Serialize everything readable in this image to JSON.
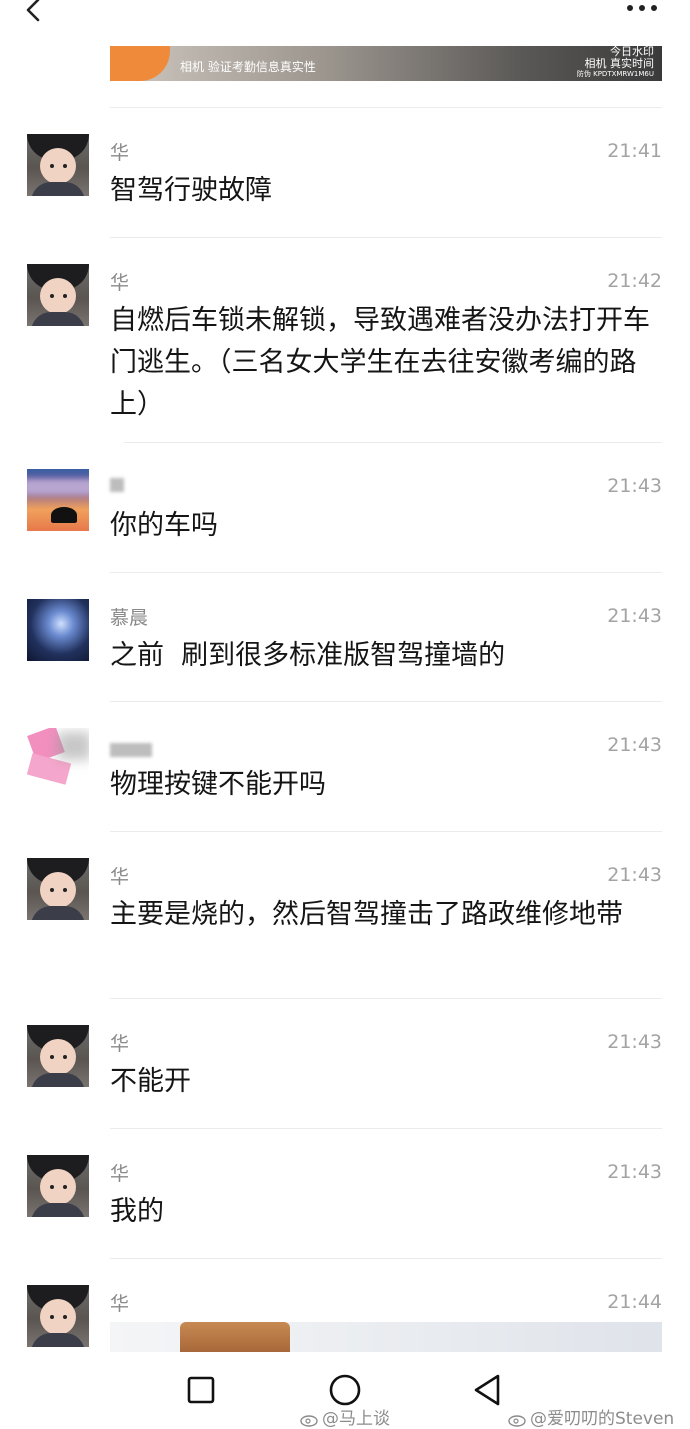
{
  "header": {
    "back_icon": "chevron-left-icon",
    "more_icon": "more-horizontal-icon"
  },
  "top_image": {
    "caption": "相机   验证考勤信息真实性",
    "watermark_line1": "今日水印",
    "watermark_line2": "相机 真实时间",
    "watermark_code": "防伪 KPDTXMRW1M6U"
  },
  "messages": [
    {
      "sender": "华",
      "time": "21:41",
      "text": "智驾行驶故障",
      "avatar": "boy"
    },
    {
      "sender": "华",
      "time": "21:42",
      "text": "自燃后车锁未解锁，导致遇难者没办法打开车门逃生。（三名女大学生在去往安徽考编的路上）",
      "avatar": "boy"
    },
    {
      "sender": "",
      "time": "21:43",
      "text": "你的车吗",
      "avatar": "sunset"
    },
    {
      "sender": "慕晨",
      "time": "21:43",
      "text": "之前  刷到很多标准版智驾撞墙的",
      "avatar": "night"
    },
    {
      "sender": "",
      "time": "21:43",
      "text": "物理按键不能开吗",
      "avatar": "pink"
    },
    {
      "sender": "华",
      "time": "21:43",
      "text": "主要是烧的，然后智驾撞击了路政维修地带",
      "avatar": "boy"
    },
    {
      "sender": "华",
      "time": "21:43",
      "text": "不能开",
      "avatar": "boy"
    },
    {
      "sender": "华",
      "time": "21:43",
      "text": "我的",
      "avatar": "boy"
    },
    {
      "sender": "华",
      "time": "21:44",
      "text": "",
      "avatar": "boy"
    }
  ],
  "navbar": {
    "square_icon": "recent-apps-icon",
    "circle_icon": "home-icon",
    "triangle_icon": "back-triangle-icon"
  },
  "credits": {
    "left": "@马上谈",
    "right": "@爱叨叨的Steven"
  }
}
